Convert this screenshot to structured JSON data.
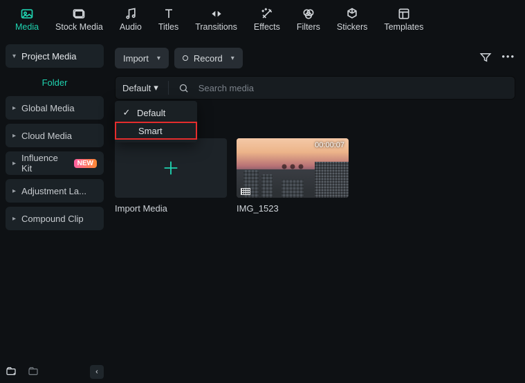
{
  "tabs": {
    "media": "Media",
    "stock": "Stock Media",
    "audio": "Audio",
    "titles": "Titles",
    "transitions": "Transitions",
    "effects": "Effects",
    "filters": "Filters",
    "stickers": "Stickers",
    "templates": "Templates"
  },
  "sidebar": {
    "project_media": "Project Media",
    "folder": "Folder",
    "global_media": "Global Media",
    "cloud_media": "Cloud Media",
    "influence_kit": "Influence Kit",
    "new_badge": "NEW",
    "adjustment": "Adjustment La...",
    "compound": "Compound Clip"
  },
  "toolbar": {
    "import_label": "Import",
    "record_label": "Record"
  },
  "search": {
    "sort_label": "Default",
    "placeholder": "Search media"
  },
  "dropdown": {
    "default": "Default",
    "smart": "Smart"
  },
  "grid": {
    "import_card": "Import Media",
    "clip1_name": "IMG_1523",
    "clip1_dur": "00:00:07"
  }
}
